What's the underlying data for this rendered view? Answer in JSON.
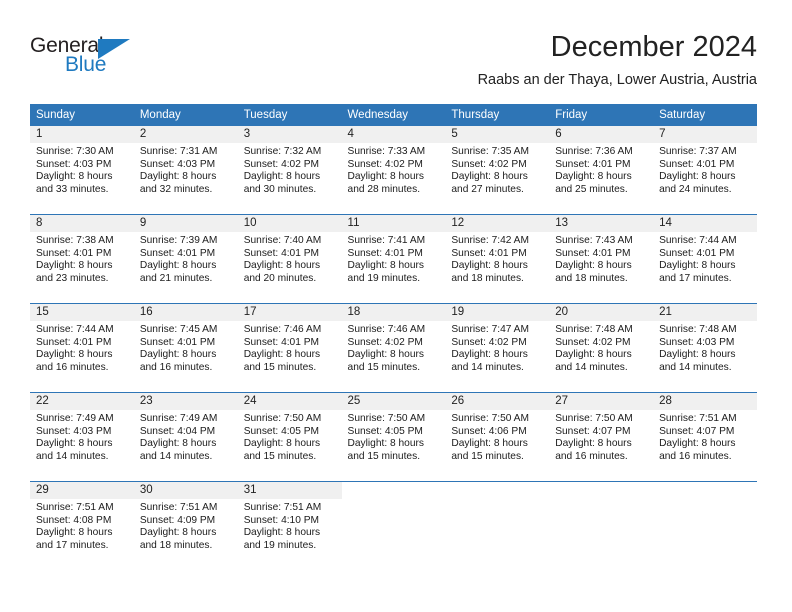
{
  "brand": {
    "name_part1": "General",
    "name_part2": "Blue",
    "accent_color": "#1f7ac0",
    "triangle_icon": "triangle-icon"
  },
  "header": {
    "title": "December 2024",
    "location": "Raabs an der Thaya, Lower Austria, Austria"
  },
  "calendar": {
    "header_bg": "#2e75b6",
    "daynum_bg": "#f0f0f0",
    "weekdays": [
      "Sunday",
      "Monday",
      "Tuesday",
      "Wednesday",
      "Thursday",
      "Friday",
      "Saturday"
    ],
    "weeks": [
      [
        {
          "day": "1",
          "lines": [
            "Sunrise: 7:30 AM",
            "Sunset: 4:03 PM",
            "Daylight: 8 hours",
            "and 33 minutes."
          ]
        },
        {
          "day": "2",
          "lines": [
            "Sunrise: 7:31 AM",
            "Sunset: 4:03 PM",
            "Daylight: 8 hours",
            "and 32 minutes."
          ]
        },
        {
          "day": "3",
          "lines": [
            "Sunrise: 7:32 AM",
            "Sunset: 4:02 PM",
            "Daylight: 8 hours",
            "and 30 minutes."
          ]
        },
        {
          "day": "4",
          "lines": [
            "Sunrise: 7:33 AM",
            "Sunset: 4:02 PM",
            "Daylight: 8 hours",
            "and 28 minutes."
          ]
        },
        {
          "day": "5",
          "lines": [
            "Sunrise: 7:35 AM",
            "Sunset: 4:02 PM",
            "Daylight: 8 hours",
            "and 27 minutes."
          ]
        },
        {
          "day": "6",
          "lines": [
            "Sunrise: 7:36 AM",
            "Sunset: 4:01 PM",
            "Daylight: 8 hours",
            "and 25 minutes."
          ]
        },
        {
          "day": "7",
          "lines": [
            "Sunrise: 7:37 AM",
            "Sunset: 4:01 PM",
            "Daylight: 8 hours",
            "and 24 minutes."
          ]
        }
      ],
      [
        {
          "day": "8",
          "lines": [
            "Sunrise: 7:38 AM",
            "Sunset: 4:01 PM",
            "Daylight: 8 hours",
            "and 23 minutes."
          ]
        },
        {
          "day": "9",
          "lines": [
            "Sunrise: 7:39 AM",
            "Sunset: 4:01 PM",
            "Daylight: 8 hours",
            "and 21 minutes."
          ]
        },
        {
          "day": "10",
          "lines": [
            "Sunrise: 7:40 AM",
            "Sunset: 4:01 PM",
            "Daylight: 8 hours",
            "and 20 minutes."
          ]
        },
        {
          "day": "11",
          "lines": [
            "Sunrise: 7:41 AM",
            "Sunset: 4:01 PM",
            "Daylight: 8 hours",
            "and 19 minutes."
          ]
        },
        {
          "day": "12",
          "lines": [
            "Sunrise: 7:42 AM",
            "Sunset: 4:01 PM",
            "Daylight: 8 hours",
            "and 18 minutes."
          ]
        },
        {
          "day": "13",
          "lines": [
            "Sunrise: 7:43 AM",
            "Sunset: 4:01 PM",
            "Daylight: 8 hours",
            "and 18 minutes."
          ]
        },
        {
          "day": "14",
          "lines": [
            "Sunrise: 7:44 AM",
            "Sunset: 4:01 PM",
            "Daylight: 8 hours",
            "and 17 minutes."
          ]
        }
      ],
      [
        {
          "day": "15",
          "lines": [
            "Sunrise: 7:44 AM",
            "Sunset: 4:01 PM",
            "Daylight: 8 hours",
            "and 16 minutes."
          ]
        },
        {
          "day": "16",
          "lines": [
            "Sunrise: 7:45 AM",
            "Sunset: 4:01 PM",
            "Daylight: 8 hours",
            "and 16 minutes."
          ]
        },
        {
          "day": "17",
          "lines": [
            "Sunrise: 7:46 AM",
            "Sunset: 4:01 PM",
            "Daylight: 8 hours",
            "and 15 minutes."
          ]
        },
        {
          "day": "18",
          "lines": [
            "Sunrise: 7:46 AM",
            "Sunset: 4:02 PM",
            "Daylight: 8 hours",
            "and 15 minutes."
          ]
        },
        {
          "day": "19",
          "lines": [
            "Sunrise: 7:47 AM",
            "Sunset: 4:02 PM",
            "Daylight: 8 hours",
            "and 14 minutes."
          ]
        },
        {
          "day": "20",
          "lines": [
            "Sunrise: 7:48 AM",
            "Sunset: 4:02 PM",
            "Daylight: 8 hours",
            "and 14 minutes."
          ]
        },
        {
          "day": "21",
          "lines": [
            "Sunrise: 7:48 AM",
            "Sunset: 4:03 PM",
            "Daylight: 8 hours",
            "and 14 minutes."
          ]
        }
      ],
      [
        {
          "day": "22",
          "lines": [
            "Sunrise: 7:49 AM",
            "Sunset: 4:03 PM",
            "Daylight: 8 hours",
            "and 14 minutes."
          ]
        },
        {
          "day": "23",
          "lines": [
            "Sunrise: 7:49 AM",
            "Sunset: 4:04 PM",
            "Daylight: 8 hours",
            "and 14 minutes."
          ]
        },
        {
          "day": "24",
          "lines": [
            "Sunrise: 7:50 AM",
            "Sunset: 4:05 PM",
            "Daylight: 8 hours",
            "and 15 minutes."
          ]
        },
        {
          "day": "25",
          "lines": [
            "Sunrise: 7:50 AM",
            "Sunset: 4:05 PM",
            "Daylight: 8 hours",
            "and 15 minutes."
          ]
        },
        {
          "day": "26",
          "lines": [
            "Sunrise: 7:50 AM",
            "Sunset: 4:06 PM",
            "Daylight: 8 hours",
            "and 15 minutes."
          ]
        },
        {
          "day": "27",
          "lines": [
            "Sunrise: 7:50 AM",
            "Sunset: 4:07 PM",
            "Daylight: 8 hours",
            "and 16 minutes."
          ]
        },
        {
          "day": "28",
          "lines": [
            "Sunrise: 7:51 AM",
            "Sunset: 4:07 PM",
            "Daylight: 8 hours",
            "and 16 minutes."
          ]
        }
      ],
      [
        {
          "day": "29",
          "lines": [
            "Sunrise: 7:51 AM",
            "Sunset: 4:08 PM",
            "Daylight: 8 hours",
            "and 17 minutes."
          ]
        },
        {
          "day": "30",
          "lines": [
            "Sunrise: 7:51 AM",
            "Sunset: 4:09 PM",
            "Daylight: 8 hours",
            "and 18 minutes."
          ]
        },
        {
          "day": "31",
          "lines": [
            "Sunrise: 7:51 AM",
            "Sunset: 4:10 PM",
            "Daylight: 8 hours",
            "and 19 minutes."
          ]
        },
        {
          "day": "",
          "lines": []
        },
        {
          "day": "",
          "lines": []
        },
        {
          "day": "",
          "lines": []
        },
        {
          "day": "",
          "lines": []
        }
      ]
    ]
  }
}
